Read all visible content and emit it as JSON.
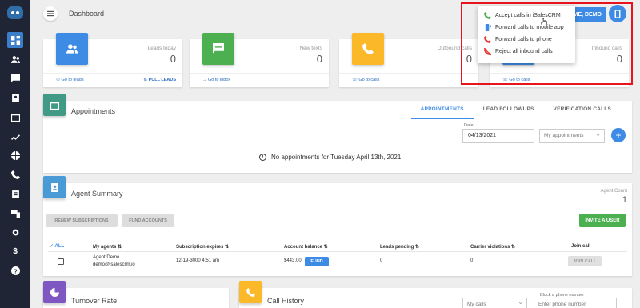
{
  "header": {
    "title": "Dashboard",
    "welcome_label": "ME, DEMO"
  },
  "stats": [
    {
      "label": "Leads today",
      "value": "0",
      "link": "Go to leads",
      "extra_link": "PULL LEADS",
      "color": "#3d8be5",
      "icon": "users-icon"
    },
    {
      "label": "New texts",
      "value": "0",
      "link": "Go to inbox",
      "color": "#4caf50",
      "icon": "message-icon"
    },
    {
      "label": "Outbound calls",
      "value": "0",
      "link": "Go to calls",
      "color": "#fbb829",
      "icon": "phone-icon"
    },
    {
      "label": "Inbound calls",
      "value": "0",
      "link": "Go to calls",
      "color": "#3d8be5",
      "icon": "phone-icon"
    }
  ],
  "call_menu": [
    {
      "label": "Accept calls in iSalesCRM",
      "icon": "phone-accept-icon",
      "color": "#4caf50"
    },
    {
      "label": "Forward calls to mobile app",
      "icon": "mobile-forward-icon",
      "color": "#3d8be5"
    },
    {
      "label": "Forward calls to phone",
      "icon": "phone-forward-icon",
      "color": "#e53935"
    },
    {
      "label": "Reject all inbound calls",
      "icon": "phone-reject-icon",
      "color": "#e53935"
    }
  ],
  "appointments": {
    "title": "Appointments",
    "tabs": [
      "APPOINTMENTS",
      "LEAD FOLLOWUPS",
      "VERIFICATION CALLS"
    ],
    "active_tab": "APPOINTMENTS",
    "date_label": "Date",
    "date_value": "04/13/2021",
    "filter_value": "My appointments",
    "empty_message": "No appointments for Tuesday April 13th, 2021.",
    "color": "#409a86"
  },
  "agent_summary": {
    "title": "Agent Summary",
    "count_label": "Agent Count",
    "count": "1",
    "renew_label": "RENEW SUBSCRIPTIONS",
    "fund_accounts_label": "FUND ACCOUNTS",
    "invite_label": "INVITE A USER",
    "all_label": "ALL",
    "columns": [
      "My agents",
      "Subscription expires",
      "Account balance",
      "Leads pending",
      "Carrier violations",
      "Join call"
    ],
    "rows": [
      {
        "name": "Agent Demo",
        "email": "demo@isalescrm.io",
        "expires": "12-19-3000 4:51 am",
        "balance": "$443.00",
        "fund_label": "FUND",
        "leads_pending": "0",
        "violations": "0",
        "join_label": "JOIN CALL"
      }
    ],
    "color": "#4a9ad6"
  },
  "turnover": {
    "title": "Turnover Rate",
    "color": "#7e57c2"
  },
  "call_history": {
    "title": "Call History",
    "filter_value": "My calls",
    "block_label": "Block a phone number",
    "block_placeholder": "Enter phone number",
    "color": "#fbb829"
  }
}
